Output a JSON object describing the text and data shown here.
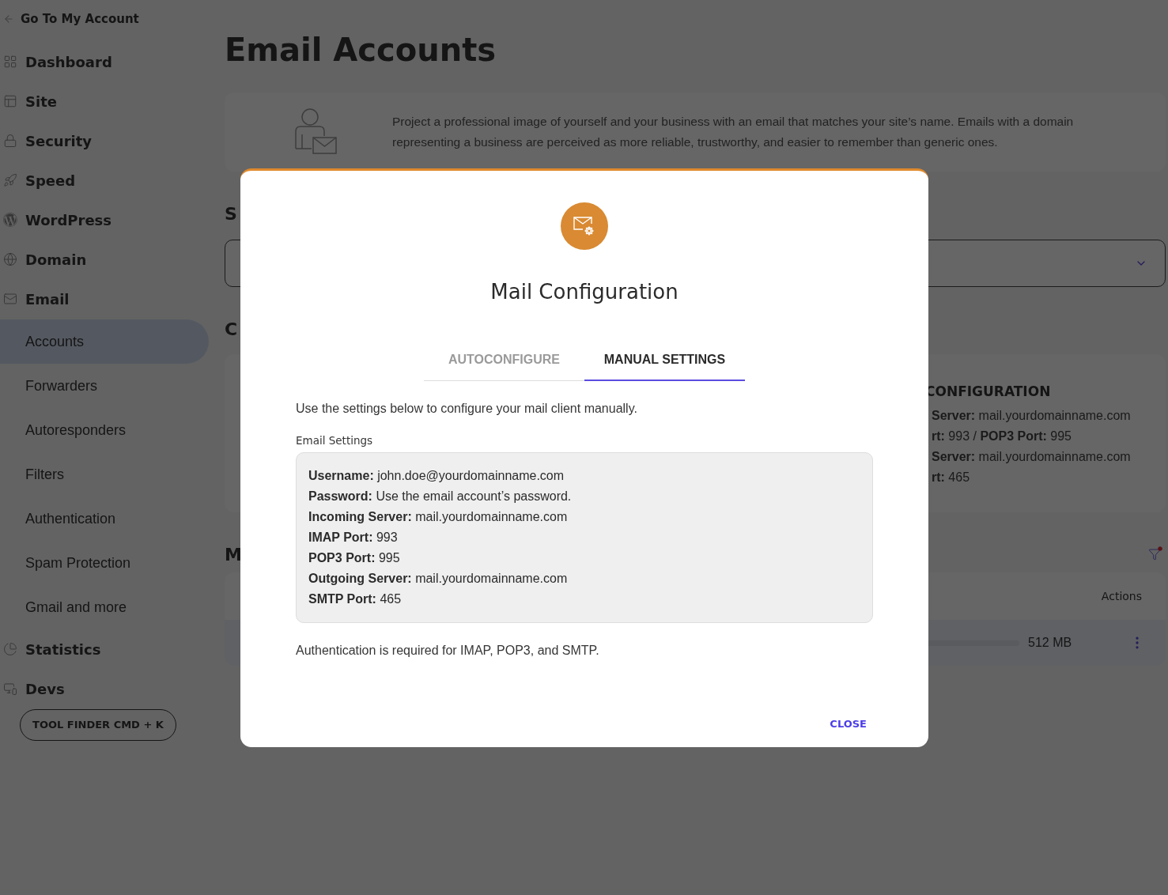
{
  "sidebar": {
    "back_link": "Go To My Account",
    "items": [
      {
        "label": "Dashboard"
      },
      {
        "label": "Site"
      },
      {
        "label": "Security"
      },
      {
        "label": "Speed"
      },
      {
        "label": "WordPress"
      },
      {
        "label": "Domain"
      },
      {
        "label": "Email",
        "children": [
          {
            "label": "Accounts",
            "selected": true
          },
          {
            "label": "Forwarders",
            "selected": false
          },
          {
            "label": "Autoresponders",
            "selected": false
          },
          {
            "label": "Filters",
            "selected": false
          },
          {
            "label": "Authentication",
            "selected": false
          },
          {
            "label": "Spam Protection",
            "selected": false
          },
          {
            "label": "Gmail and more",
            "selected": false
          }
        ]
      },
      {
        "label": "Statistics"
      },
      {
        "label": "Devs"
      }
    ],
    "tool_finder": "TOOL FINDER CMD + K"
  },
  "page": {
    "title": "Email Accounts",
    "intro": "Project a professional image of yourself and your business with an email that matches your site’s name. Emails with a domain representing a business are perceived as more reliable, trustworthy, and easier to remember than generic ones.",
    "select_heading": "S",
    "create_heading": "C",
    "config_card": {
      "title": "CONFIGURATION",
      "lines": [
        "**Server:** mail.yourdomainname.com",
        "**rt:** 993 / **POP3 Port:** 995",
        "**Server:** mail.yourdomainname.com",
        "**rt:** 465"
      ]
    },
    "manage_heading": "M",
    "table": {
      "actions_column": "Actions",
      "row": {
        "quota": "512 MB"
      }
    }
  },
  "modal": {
    "title": "Mail Configuration",
    "tabs": [
      {
        "label": "AUTOCONFIGURE",
        "selected": false
      },
      {
        "label": "MANUAL SETTINGS",
        "selected": true
      }
    ],
    "description": "Use the settings below to configure your mail client manually.",
    "settings_label": "Email Settings",
    "settings": [
      {
        "label": "Username:",
        "value": "john.doe@yourdomainname.com"
      },
      {
        "label": "Password:",
        "value": "Use the email account’s password."
      },
      {
        "label": "Incoming Server:",
        "value": "mail.yourdomainname.com"
      },
      {
        "label": "IMAP Port:",
        "value": "993"
      },
      {
        "label": "POP3 Port:",
        "value": "995"
      },
      {
        "label": "Outgoing Server:",
        "value": "mail.yourdomainname.com"
      },
      {
        "label": "SMTP Port:",
        "value": "465"
      }
    ],
    "note": "Authentication is required for IMAP, POP3, and SMTP.",
    "close_button": "CLOSE"
  }
}
